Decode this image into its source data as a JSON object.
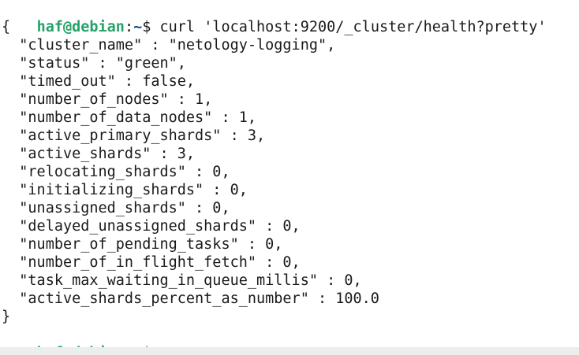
{
  "colors": {
    "prompt_user": "#26a269",
    "prompt_path": "#12488b",
    "text": "#1a1a1a",
    "background": "#ffffff"
  },
  "prompt": {
    "user_host": "haf@debian",
    "separator": ":",
    "path": "~",
    "symbol": "$"
  },
  "command": " curl 'localhost:9200/_cluster/health?pretty'",
  "output": {
    "open": "{",
    "lines": [
      "  \"cluster_name\" : \"netology-logging\",",
      "  \"status\" : \"green\",",
      "  \"timed_out\" : false,",
      "  \"number_of_nodes\" : 1,",
      "  \"number_of_data_nodes\" : 1,",
      "  \"active_primary_shards\" : 3,",
      "  \"active_shards\" : 3,",
      "  \"relocating_shards\" : 0,",
      "  \"initializing_shards\" : 0,",
      "  \"unassigned_shards\" : 0,",
      "  \"delayed_unassigned_shards\" : 0,",
      "  \"number_of_pending_tasks\" : 0,",
      "  \"number_of_in_flight_fetch\" : 0,",
      "  \"task_max_waiting_in_queue_millis\" : 0,",
      "  \"active_shards_percent_as_number\" : 100.0"
    ],
    "close": "}"
  }
}
